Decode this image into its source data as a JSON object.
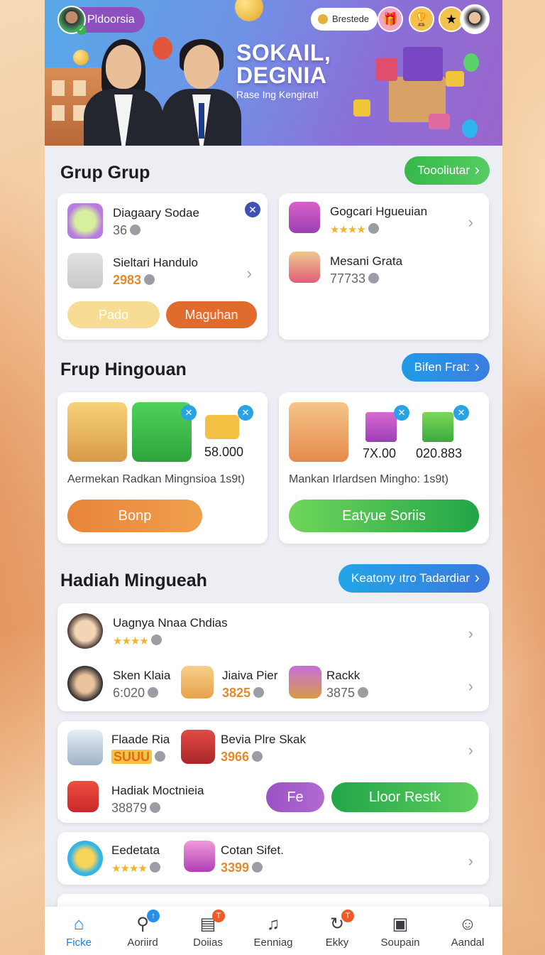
{
  "header": {
    "profile_name": "Pldoorsia",
    "coin_label": "Brestede",
    "hero_title_line1": "SOKAIL,",
    "hero_title_line2": "DEGNIA",
    "hero_subtitle": "Rase Ing Kengirat!"
  },
  "sections": [
    {
      "title": "Grup Grup",
      "action_label": "Toooliutar",
      "left_card": {
        "rows": [
          {
            "title": "Diagaary Sodae",
            "value": "36"
          },
          {
            "title": "Sieltari Handulo",
            "value": "2983"
          }
        ],
        "buttons": [
          "Pado",
          "Maguhan"
        ]
      },
      "right_card": {
        "rows": [
          {
            "title": "Gogcari Hgueuian",
            "value": ""
          },
          {
            "title": "Mesani Grata",
            "value": "77733"
          }
        ]
      }
    },
    {
      "title": "Frup Hingouan",
      "action_label": "Bifen Frat:",
      "left_card": {
        "tile_value": "58.000",
        "caption": "Aermekan Radkan Mingnsioa 1s9t)",
        "button": "Bonp"
      },
      "right_card": {
        "values": [
          "7X.00",
          "020.883"
        ],
        "caption": "Mankan Irlardsen Mingho: 1s9t)",
        "button": "Eatyue Soriis"
      }
    },
    {
      "title": "Hadiah Minguеah",
      "action_label": "Keatony ıtro Tadardiar",
      "card1": {
        "top_row": {
          "title": "Uagnya Nnaa Chdias"
        },
        "items": [
          {
            "title": "Sken Klaia",
            "value": "6:020"
          },
          {
            "title": "Jiaiva Pier",
            "value": "3825"
          },
          {
            "title": "Rackk",
            "value": "3875"
          }
        ]
      },
      "card2": {
        "items": [
          {
            "title": "Flaade Ria",
            "value": "SUUU"
          },
          {
            "title": "Bevia Plre Skak",
            "value": "3966"
          },
          {
            "title": "Hadiak Moctnieia",
            "value": "38879"
          }
        ],
        "buttons": [
          "Fe",
          "Lloor Restk"
        ]
      },
      "card3": {
        "items": [
          {
            "title": "Eedetata",
            "value": ""
          },
          {
            "title": "Cotan Sifet.",
            "value": "3399"
          }
        ]
      }
    }
  ],
  "nav": [
    {
      "label": "Ficke",
      "icon": "home-icon"
    },
    {
      "label": "Aoriird",
      "icon": "activity-icon"
    },
    {
      "label": "Doiias",
      "icon": "document-icon"
    },
    {
      "label": "Eenniag",
      "icon": "bell-icon"
    },
    {
      "label": "Ekky",
      "icon": "refresh-icon"
    },
    {
      "label": "Soupain",
      "icon": "calendar-icon"
    },
    {
      "label": "Aandal",
      "icon": "profile-icon"
    }
  ],
  "colors": {
    "green": "#3dbb4c",
    "blue": "#2a8fe4",
    "orange": "#e8772f",
    "purple": "#8a4fc0"
  }
}
